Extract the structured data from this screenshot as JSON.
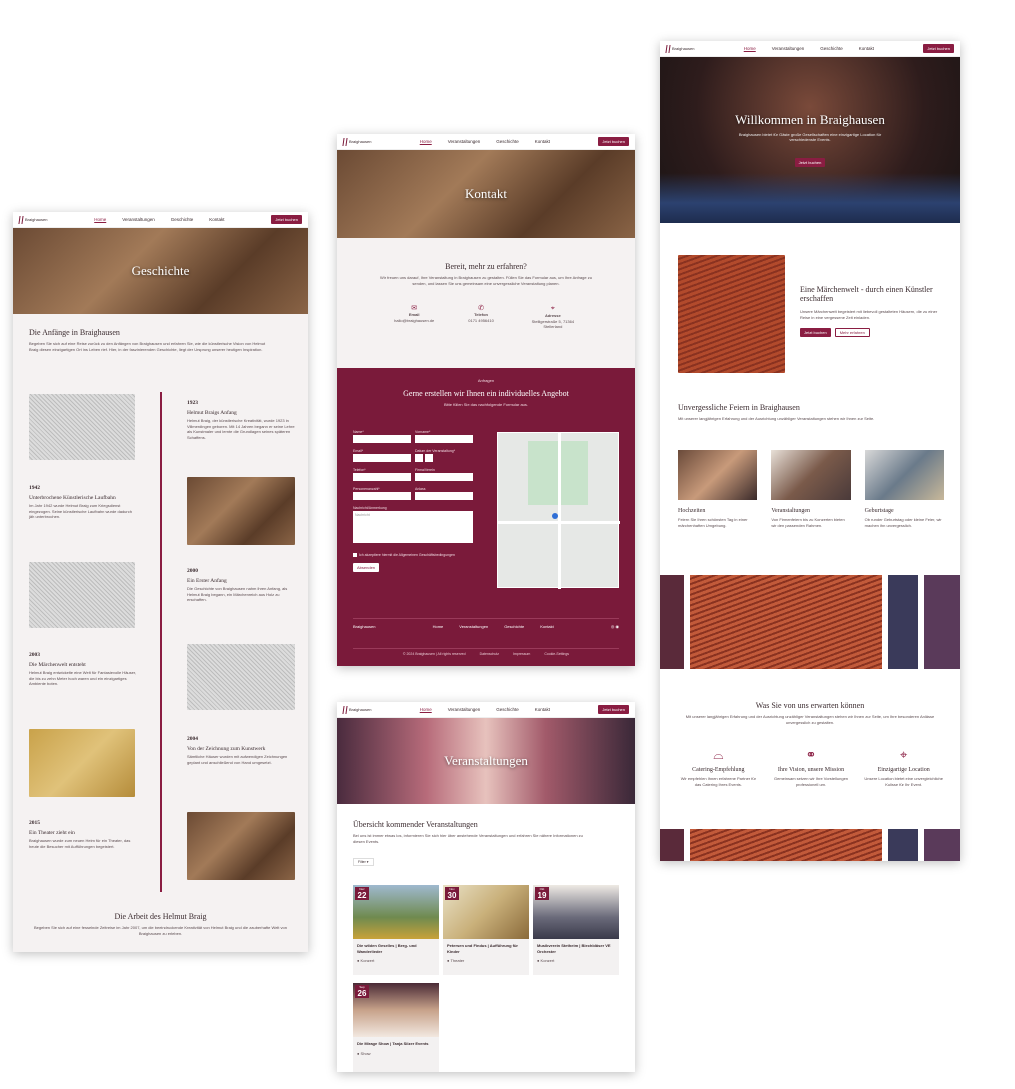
{
  "brand": "Braighausen",
  "nav": {
    "home": "Home",
    "events": "Veranstaltungen",
    "history": "Geschichte",
    "contact": "Kontakt",
    "book": "Jetzt buchen"
  },
  "history": {
    "hero": "Geschichte",
    "intro_title": "Die Anfänge in Braighausen",
    "intro_text": "Begeben Sie sich auf eine Reise zurück zu den Anfängen von Braighausen und erfahren Sie, wie die künstlerische Vision von Helmut Braig diesen einzigartigen Ort ins Leben rief. Hier, in der faszinierenden Geschichte, liegt der Ursprung unserer heutigen Inspiration.",
    "timeline": [
      {
        "year": "1923",
        "title": "Helmut Braigs Anfang",
        "text": "Helmut Braig, der künstlerische Kreativität, wurde 1923 in Villmerdingen geboren. Mit 14 Jahren begann er seine Lehre als Kunstmaler und lernte die Grundlagen seines späteren Schaffens."
      },
      {
        "year": "1942",
        "title": "Unterbrochene Künstlerische Laufbahn",
        "text": "Im Jahr 1942 wurde Helmut Braig zum Kriegsdienst eingezogen. Seine künstlerische Laufbahn wurde dadurch jäh unterbrochen."
      },
      {
        "year": "2000",
        "title": "Ein Erster Anfang",
        "text": "Die Geschichte von Braighausen nahm ihren Anfang, als Helmut Braig begann, ein Märchenreich aus Holz zu erschaffen."
      },
      {
        "year": "2003",
        "title": "Die Märchenwelt entsteht",
        "text": "Helmut Braig entwickelte eine Welt für Fantasievolle Häuser, die bis zu zehn Meter hoch waren und ein einzigartiges Ambiente boten."
      },
      {
        "year": "2004",
        "title": "Von der Zeichnung zum Kunstwerk",
        "text": "Sämtliche Häuser wurden mit aufwendigen Zeichnungen geplant und anschließend von Hand umgesetzt."
      },
      {
        "year": "2015",
        "title": "Ein Theater zieht ein",
        "text": "Braighausen wurde zum neuen Heim für ein Theater, das heute die Besucher mit Aufführungen begeistert."
      }
    ],
    "work_title": "Die Arbeit des Helmut Braig",
    "work_text": "Begeben Sie sich auf eine fesselnde Zeitreise im Jahr 2007, um die beeindruckende Kreativität von Helmut Braig und die zauberhafte Welt von Braighausen zu erleben."
  },
  "contact": {
    "hero": "Kontakt",
    "ask_title": "Bereit, mehr zu erfahren?",
    "ask_text": "Wir freuen uns darauf, Ihre Veranstaltung in Braighausen zu gestalten. Füllen Sie das Formular aus, um Ihre Anfrage zu senden, und lassen Sie uns gemeinsam eine unvergessliche Veranstaltung planen.",
    "email_label": "Email",
    "email_value": "hallo@braighausen.de",
    "phone_label": "Telefon",
    "phone_value": "0171 4956410",
    "address_label": "Adresse",
    "address_value": "Stelligerstraße 5, 71364 Stellerland",
    "form_kicker": "Anfragen",
    "form_title": "Gerne erstellen wir Ihnen ein individuelles Angebot",
    "form_sub": "Bitte füllen Sie das nachfolgende Formular aus.",
    "f_name": "Name*",
    "f_firstname": "Vorname*",
    "f_email": "Email*",
    "f_date": "Datum der Veranstaltung*",
    "f_phone": "Telefon*",
    "f_company": "Firma/Verein",
    "f_guests": "Personenanzahl*",
    "f_occasion": "Anlass",
    "f_message": "Nachricht/Anmerkung",
    "f_message_ph": "Nachricht",
    "f_privacy": "Ich akzeptiere hiermit die Allgemeinen Geschäftsbedingungen",
    "f_submit": "Absenden",
    "footer_copy": "© 2024 Braighausen | All rights reserved",
    "footer_privacy": "Datenschutz",
    "footer_imprint": "Impressum",
    "footer_cookies": "Cookie-Settings"
  },
  "events": {
    "hero": "Veranstaltungen",
    "title": "Übersicht kommender Veranstaltungen",
    "text": "Bei uns ist immer etwas los, informieren Sie sich hier über anstehende Veranstaltungen und erfahren Sie nähere Informationen zu diesen Events.",
    "filter": "Filter",
    "cards": [
      {
        "month": "Dez",
        "day": "22",
        "title": "Die wilden Geselles | Berg- und Wanderlieder",
        "tag": "Konzert"
      },
      {
        "month": "Nov",
        "day": "30",
        "title": "Petersen und Findus | Aufführung für Kinder",
        "tag": "Theater"
      },
      {
        "month": "Okt",
        "day": "19",
        "title": "Musikverein Stetheim | Blechbläser VE Orchester",
        "tag": "Konzert"
      },
      {
        "month": "Sep",
        "day": "26",
        "title": "Die Mirage Show | Tanja Silzer Events",
        "tag": "Show"
      }
    ]
  },
  "home": {
    "hero_title": "Willkommen in Braighausen",
    "hero_text": "Braighausen bietet für Gäste große Gesellschaften eine einzigartige Location für verschiedenste Events.",
    "hero_btn": "Jetzt buchen",
    "world_title": "Eine Märchenwelt - durch einen Künstler erschaffen",
    "world_text": "Unsere Märchenwelt begeistert mit liebevoll gestalteten Häusern, die zu einer Reise in eine vergessene Zeit einladen.",
    "world_btn": "Jetzt buchen",
    "world_more": "Mehr erfahren",
    "celebr_title": "Unvergessliche Feiern in Braighausen",
    "celebr_text": "Mit unserer langjährigen Erfahrung und der Ausrichtung unzähliger Veranstaltungen stehen wir Ihnen zur Seite.",
    "cats": [
      {
        "title": "Hochzeiten",
        "text": "Feiern Sie Ihren schönsten Tag in einer märchenhaften Umgebung."
      },
      {
        "title": "Veranstaltungen",
        "text": "Von Firmenfeiern bis zu Konzerten bieten wir den passenden Rahmen."
      },
      {
        "title": "Geburtstage",
        "text": "Ob runder Geburtstag oder kleine Feier, wir machen ihn unvergesslich."
      }
    ],
    "expect_title": "Was Sie von uns erwarten können",
    "expect_text": "Mit unserer langjährigen Erfahrung und der Ausrichtung unzähliger Veranstaltungen stehen wir Ihnen zur Seite, um Ihre besonderen Anlässe unvergesslich zu gestalten.",
    "features": [
      {
        "icon": "cloche-icon",
        "title": "Catering-Empfehlung",
        "text": "Wir empfehlen Ihnen erfahrene Partner für das Catering Ihres Events."
      },
      {
        "icon": "handshake-icon",
        "title": "Ihre Vision, unsere Mission",
        "text": "Gemeinsam setzen wir Ihre Vorstellungen professionell um."
      },
      {
        "icon": "location-pin-icon",
        "title": "Einzigartige Location",
        "text": "Unsere Location bietet eine unvergleichliche Kulisse für Ihr Event."
      }
    ]
  },
  "colors": {
    "accent": "#8a1d42",
    "dark": "#6e1533"
  }
}
